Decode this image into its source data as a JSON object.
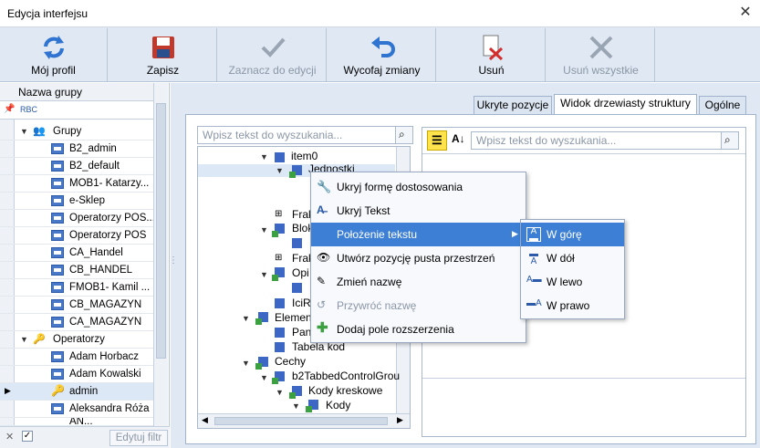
{
  "window": {
    "title": "Edycja interfejsu",
    "close": "✕"
  },
  "toolbar": {
    "buttons": [
      {
        "label": "Mój profil",
        "icon": "refresh-icon",
        "enabled": true
      },
      {
        "label": "Zapisz",
        "icon": "save-icon",
        "enabled": true
      },
      {
        "label": "Zaznacz do edycji",
        "icon": "check-icon",
        "enabled": false
      },
      {
        "label": "Wycofaj zmiany",
        "icon": "undo-icon",
        "enabled": true
      },
      {
        "label": "Usuń",
        "icon": "delete-icon",
        "enabled": true
      },
      {
        "label": "Usuń wszystkie",
        "icon": "delete-all-icon",
        "enabled": false
      }
    ]
  },
  "left": {
    "column_header": "Nazwa grupy",
    "filter_label": "RBC",
    "groups_label": "Grupy",
    "groups": [
      "B2_admin",
      "B2_default",
      "MOB1- Katarzy...",
      "e-Sklep",
      "Operatorzy POS...",
      "Operatorzy POS",
      "CA_Handel",
      "CB_HANDEL",
      "FMOB1- Kamil ...",
      "CB_MAGAZYN",
      "CA_MAGAZYN"
    ],
    "operators_label": "Operatorzy",
    "operators": [
      "Adam Horbacz",
      "Adam Kowalski",
      "admin",
      "Aleksandra Róża",
      "AN..."
    ],
    "edit_filter": "Edytuj filtr"
  },
  "tabs": [
    "Ukryte pozycje",
    "Widok drzewiasty struktury",
    "Ogólne"
  ],
  "search": {
    "left_placeholder": "Wpisz tekst do wyszukania...",
    "right_placeholder": "Wpisz tekst do wyszukania..."
  },
  "tree": {
    "item0": "item0",
    "jednostki": "Jednostki",
    "frak1": "Frak",
    "blok": "Blok",
    "frak2": "Frak",
    "opis": "Opi",
    "ici": "IciR",
    "element": "Element",
    "pan": "Pan",
    "tabela": "Tabela kod",
    "cechy": "Cechy",
    "b2tab": "b2TabbedControlGrou",
    "kody_kreskowe": "Kody kreskowe",
    "kody": "Kody"
  },
  "context_menu": {
    "items": [
      {
        "label": "Ukryj formę dostosowania",
        "icon": "wrench-icon",
        "enabled": true
      },
      {
        "label": "Ukryj Tekst",
        "icon": "text-hide-icon",
        "enabled": true
      },
      {
        "label": "Położenie tekstu",
        "icon": "",
        "enabled": true,
        "submenu": true,
        "highlighted": true
      },
      {
        "label": "Utwórz pozycję pusta przestrzeń",
        "icon": "eye-icon",
        "enabled": true
      },
      {
        "label": "Zmień nazwę",
        "icon": "rename-icon",
        "enabled": true
      },
      {
        "label": "Przywróć nazwę",
        "icon": "restore-icon",
        "enabled": false
      },
      {
        "label": "Dodaj pole rozszerzenia",
        "icon": "plus-icon",
        "enabled": true
      }
    ],
    "submenu": [
      "W górę",
      "W dół",
      "W lewo",
      "W prawo"
    ]
  }
}
